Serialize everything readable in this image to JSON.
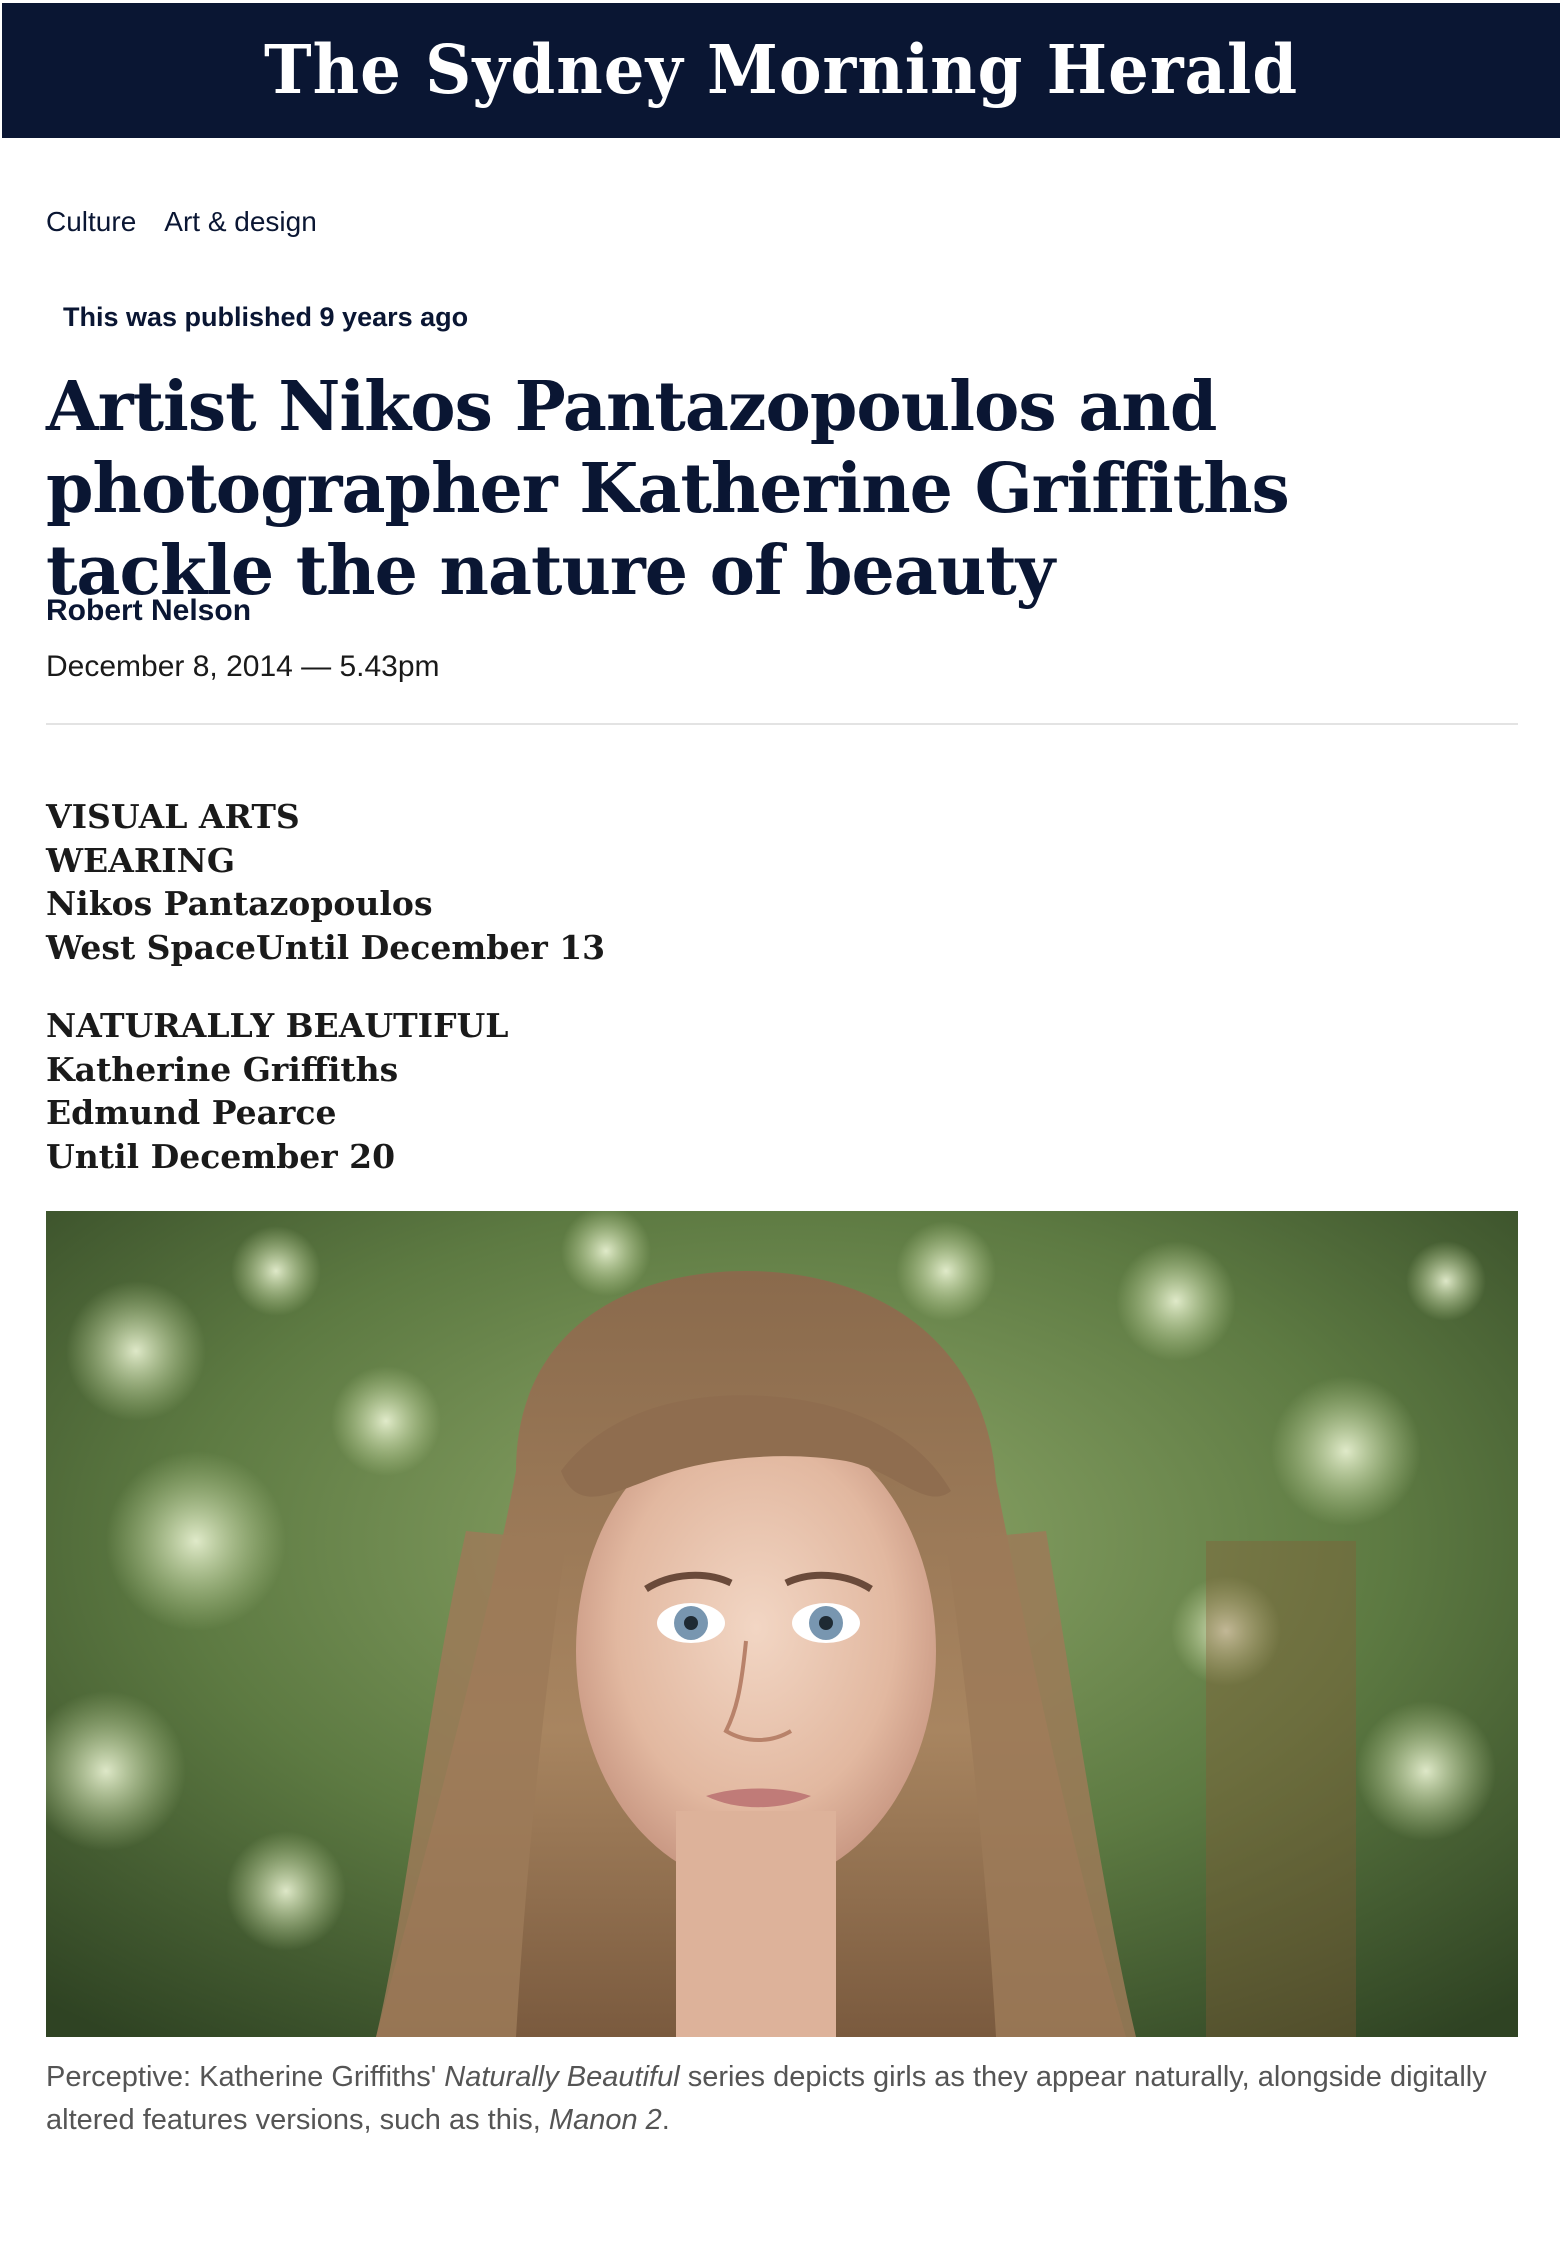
{
  "masthead": {
    "title": "The Sydney Morning Herald"
  },
  "breadcrumb": {
    "section": "Culture",
    "subsection": "Art & design"
  },
  "article": {
    "published_notice": "This was published 9 years ago",
    "headline": "Artist Nikos Pantazopoulos and photographer Katherine Griffiths tackle the nature of beauty",
    "author": "Robert Nelson",
    "dateline": "December 8, 2014 — 5.43pm",
    "info_block_1": [
      "VISUAL ARTS",
      "WEARING",
      "Nikos Pantazopoulos",
      "West SpaceUntil December 13"
    ],
    "info_block_2": [
      "NATURALLY BEAUTIFUL",
      "Katherine Griffiths",
      "Edmund Pearce",
      "Until December 20"
    ],
    "caption": {
      "part1": "Perceptive: Katherine Griffiths' ",
      "italic1": "Naturally Beautiful",
      "part2": " series depicts girls as they appear naturally, alongside digitally altered features versions, such as this, ",
      "italic2": "Manon 2",
      "part3": "."
    }
  },
  "colors": {
    "masthead_bg": "#0a1633",
    "text": "#0a1633",
    "caption": "#555555"
  }
}
